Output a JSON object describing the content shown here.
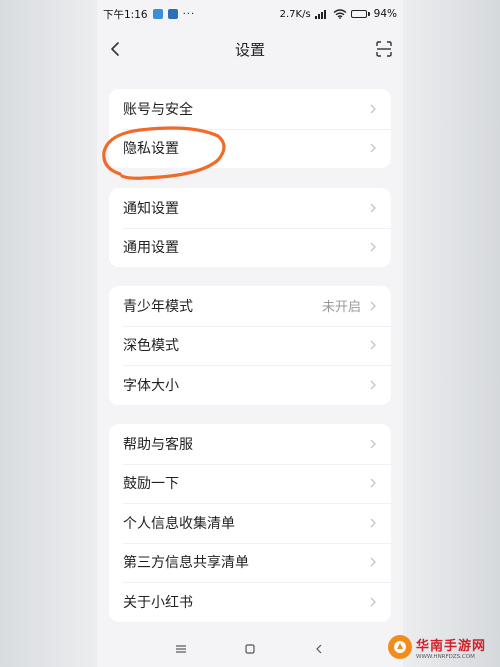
{
  "status_bar": {
    "time": "下午1:16",
    "more": "···",
    "net_speed": "2.7K/s",
    "battery": "94%",
    "battery_level": 0.94
  },
  "header": {
    "title": "设置"
  },
  "groups": [
    {
      "items": [
        {
          "label": "账号与安全"
        },
        {
          "label": "隐私设置"
        }
      ]
    },
    {
      "items": [
        {
          "label": "通知设置"
        },
        {
          "label": "通用设置"
        }
      ]
    },
    {
      "items": [
        {
          "label": "青少年模式",
          "value": "未开启"
        },
        {
          "label": "深色模式"
        },
        {
          "label": "字体大小"
        }
      ]
    },
    {
      "items": [
        {
          "label": "帮助与客服"
        },
        {
          "label": "鼓励一下"
        },
        {
          "label": "个人信息收集清单"
        },
        {
          "label": "第三方信息共享清单"
        },
        {
          "label": "关于小红书"
        }
      ]
    }
  ],
  "watermark": {
    "title": "华南手游网",
    "subtitle": "WWW.HNRFDZS.COM"
  },
  "colors": {
    "highlight_ring": "#f06a2a",
    "watermark_red": "#cf1f28"
  },
  "icons": [
    "back-icon",
    "scan-icon",
    "chevron-right-icon",
    "wifi-icon",
    "signal-icon",
    "battery-icon",
    "menu-icon",
    "home-icon",
    "back-nav-icon"
  ]
}
